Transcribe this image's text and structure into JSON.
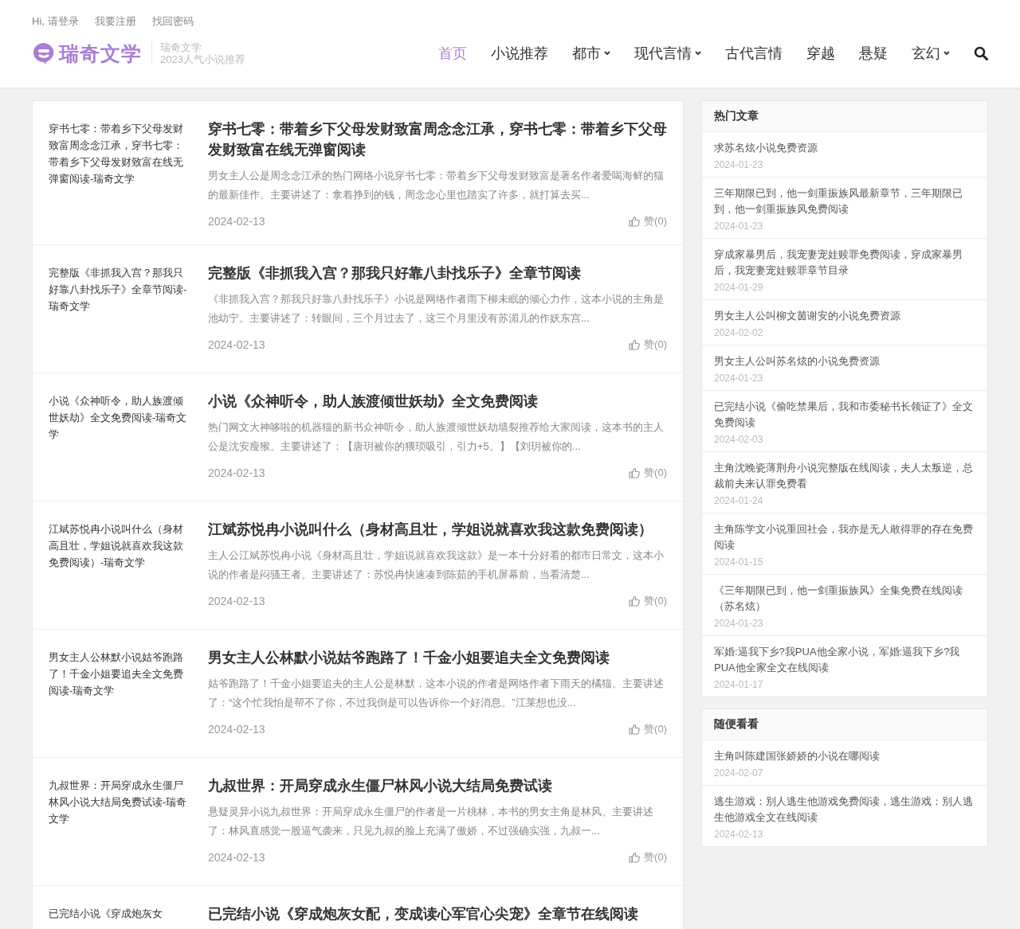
{
  "top_links": [
    "Hi, 请登录",
    "我要注册",
    "找回密码"
  ],
  "logo": {
    "name": "瑞奇文学",
    "tagline_1": "瑞奇文学",
    "tagline_2": "2023人气小说推荐"
  },
  "nav": [
    {
      "label": "首页",
      "selected": true,
      "dropdown": false
    },
    {
      "label": "小说推荐",
      "selected": false,
      "dropdown": false
    },
    {
      "label": "都市",
      "selected": false,
      "dropdown": true
    },
    {
      "label": "现代言情",
      "selected": false,
      "dropdown": true
    },
    {
      "label": "古代言情",
      "selected": false,
      "dropdown": false
    },
    {
      "label": "穿越",
      "selected": false,
      "dropdown": false
    },
    {
      "label": "悬疑",
      "selected": false,
      "dropdown": false
    },
    {
      "label": "玄幻",
      "selected": false,
      "dropdown": true
    }
  ],
  "articles": [
    {
      "thumb_text": "穿书七零：带着乡下父母发财致富周念念江承，穿书七零：带着乡下父母发财致富在线无弹窗阅读-瑞奇文学",
      "title": "穿书七零：带着乡下父母发财致富周念念江承，穿书七零：带着乡下父母发财致富在线无弹窗阅读",
      "excerpt": "男女主人公是周念念江承的热门网络小说穿书七零：带着乡下父母发财致富是著名作者爱喝海鲜的猫的最新佳作。主要讲述了：拿着挣到的钱，周念念心里也踏实了许多，就打算去买...",
      "date": "2024-02-13",
      "likes": "赞(0)"
    },
    {
      "thumb_text": "完整版《非抓我入宫？那我只好靠八卦找乐子》全章节阅读-瑞奇文学",
      "title": "完整版《非抓我入宫？那我只好靠八卦找乐子》全章节阅读",
      "excerpt": "《非抓我入宫？那我只好靠八卦找乐子》小说是网络作者雨下柳未眠的倾心力作，这本小说的主角是池幼宁。主要讲述了：转眼间，三个月过去了，这三个月里没有苏湄儿的作妖东宫...",
      "date": "2024-02-13",
      "likes": "赞(0)"
    },
    {
      "thumb_text": "小说《众神听令，助人族渡倾世妖劫》全文免费阅读-瑞奇文学",
      "title": "小说《众神听令，助人族渡倾世妖劫》全文免费阅读",
      "excerpt": "热门网文大神哆啦的机器猫的新书众神听令，助人族渡倾世妖劫墙裂推荐给大家阅读，这本书的主人公是沈安瘦猴。主要讲述了：【唐玥被你的猥琐吸引，引力+5。】【刘玥被你的...",
      "date": "2024-02-13",
      "likes": "赞(0)"
    },
    {
      "thumb_text": "江斌苏悦冉小说叫什么（身材高且壮，学姐说就喜欢我这款免费阅读）-瑞奇文学",
      "title": "江斌苏悦冉小说叫什么（身材高且壮，学姐说就喜欢我这款免费阅读）",
      "excerpt": "主人公江斌苏悦冉小说《身材高且壮，学姐说就喜欢我这款》是一本十分好看的都市日常文，这本小说的作者是闷骚王者。主要讲述了：苏悦冉快速凑到陈茹的手机屏幕前，当看清楚...",
      "date": "2024-02-13",
      "likes": "赞(0)"
    },
    {
      "thumb_text": "男女主人公林默小说姑爷跑路了！千金小姐要追夫全文免费阅读-瑞奇文学",
      "title": "男女主人公林默小说姑爷跑路了！千金小姐要追夫全文免费阅读",
      "excerpt": "姑爷跑路了！千金小姐要追夫的主人公是林默，这本小说的作者是网络作者下雨天的橘猫。主要讲述了：“这个忙我怕是帮不了你，不过我倒是可以告诉你一个好消息。”江莱想也没...",
      "date": "2024-02-13",
      "likes": "赞(0)"
    },
    {
      "thumb_text": "九叔世界：开局穿成永生僵尸林风小说大结局免费试读-瑞奇文学",
      "title": "九叔世界：开局穿成永生僵尸林风小说大结局免费试读",
      "excerpt": "悬疑灵异小说九叔世界：开局穿成永生僵尸的作者是一片桃林，本书的男女主角是林风。主要讲述了：林风直感觉一股逼气袭来，只见九叔的脸上充满了傲娇，不过强确实强，九叔一...",
      "date": "2024-02-13",
      "likes": "赞(0)"
    },
    {
      "thumb_text": "已完结小说《穿成炮灰女",
      "title": "已完结小说《穿成炮灰女配，变成读心军官心尖宠》全章节在线阅读"
    }
  ],
  "sidebar": [
    {
      "title": "热门文章",
      "items": [
        {
          "title": "求苏名炫小说免费资源",
          "date": "2024-01-23"
        },
        {
          "title": "三年期限已到，他一剑重振族风最新章节，三年期限已到，他一剑重振族风免费阅读",
          "date": "2024-01-23"
        },
        {
          "title": "穿成家暴男后，我宠妻宠娃赎罪免费阅读，穿成家暴男后，我宠妻宠娃赎罪章节目录",
          "date": "2024-01-29"
        },
        {
          "title": "男女主人公叫柳文茵谢安的小说免费资源",
          "date": "2024-02-02"
        },
        {
          "title": "男女主人公叫苏名炫的小说免费资源",
          "date": "2024-01-23"
        },
        {
          "title": "已完结小说《偷吃禁果后，我和市委秘书长领证了》全文免费阅读",
          "date": "2024-02-03"
        },
        {
          "title": "主角沈晚瓷薄荆舟小说完整版在线阅读，夫人太叛逆，总裁前夫来认罪免费看",
          "date": "2024-01-24"
        },
        {
          "title": "主角陈学文小说重回社会，我亦是无人敢得罪的存在免费阅读",
          "date": "2024-01-15"
        },
        {
          "title": "《三年期限已到，他一剑重振族风》全集免费在线阅读（苏名炫）",
          "date": "2024-01-23"
        },
        {
          "title": "军婚:逼我下乡?我PUA他全家小说，军婚:逼我下乡?我PUA他全家全文在线阅读",
          "date": "2024-01-17"
        }
      ]
    },
    {
      "title": "随便看看",
      "items": [
        {
          "title": "主角叫陈建国张娇娇的小说在哪阅读",
          "date": "2024-02-07"
        },
        {
          "title": "逃生游戏：别人逃生他游戏免费阅读，逃生游戏：别人逃生他游戏全文在线阅读",
          "date": "2024-02-13"
        }
      ]
    }
  ]
}
